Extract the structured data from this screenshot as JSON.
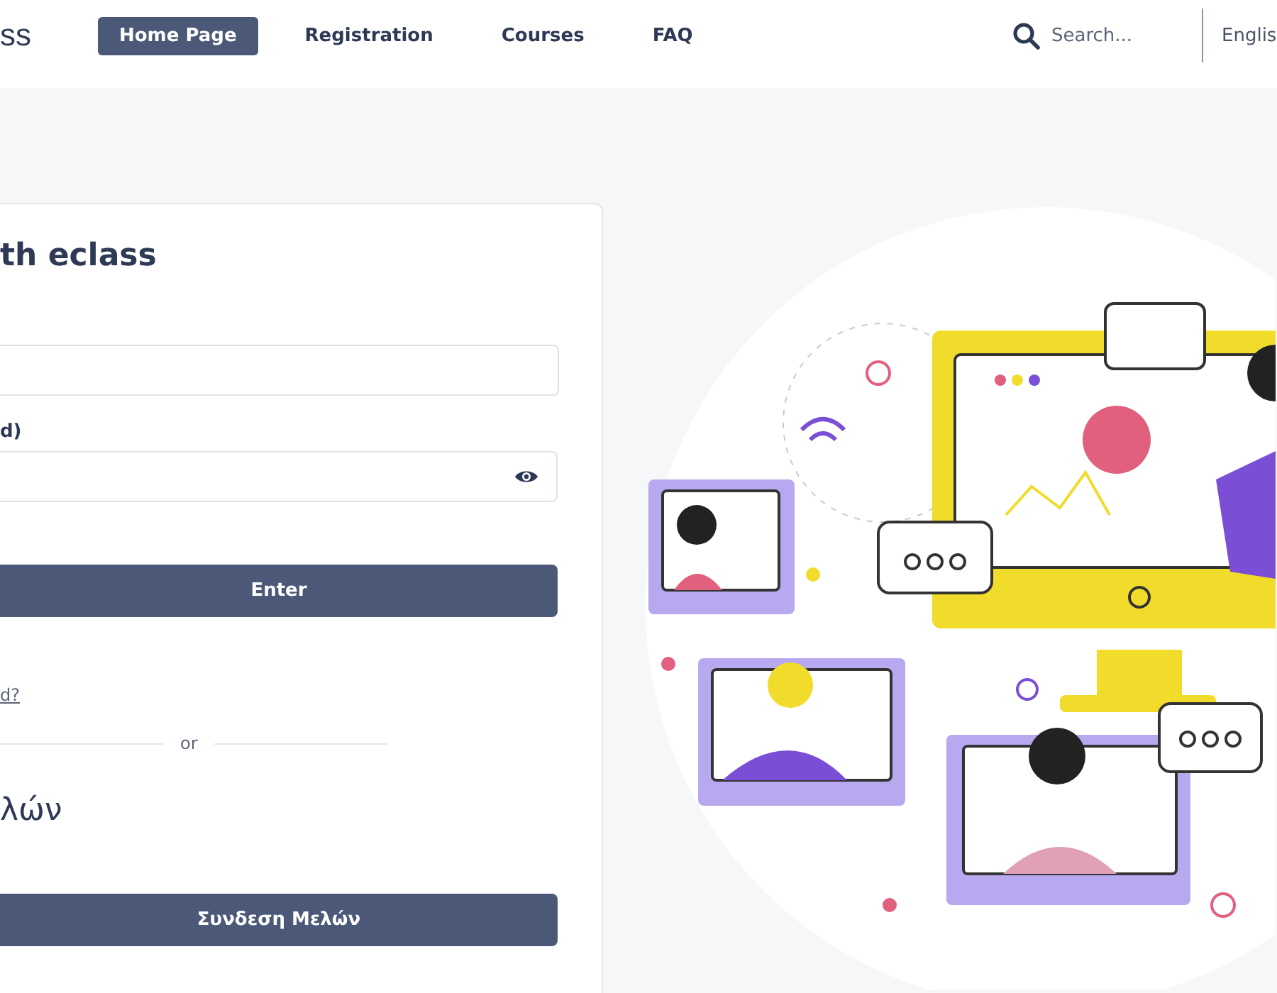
{
  "header": {
    "logo": "ss",
    "nav": [
      {
        "label": "Home Page",
        "selected": true
      },
      {
        "label": "Registration",
        "selected": false
      },
      {
        "label": "Courses",
        "selected": false
      },
      {
        "label": "FAQ",
        "selected": false
      }
    ],
    "search": {
      "placeholder": "Search..."
    },
    "language": "Englis"
  },
  "login_card": {
    "title": "th eclass",
    "password_label": "d)",
    "enter_button": "Enter",
    "forgot_link": "d?",
    "divider": "or",
    "members_title": "λών",
    "members_button": "Συνδεση Μελών"
  }
}
